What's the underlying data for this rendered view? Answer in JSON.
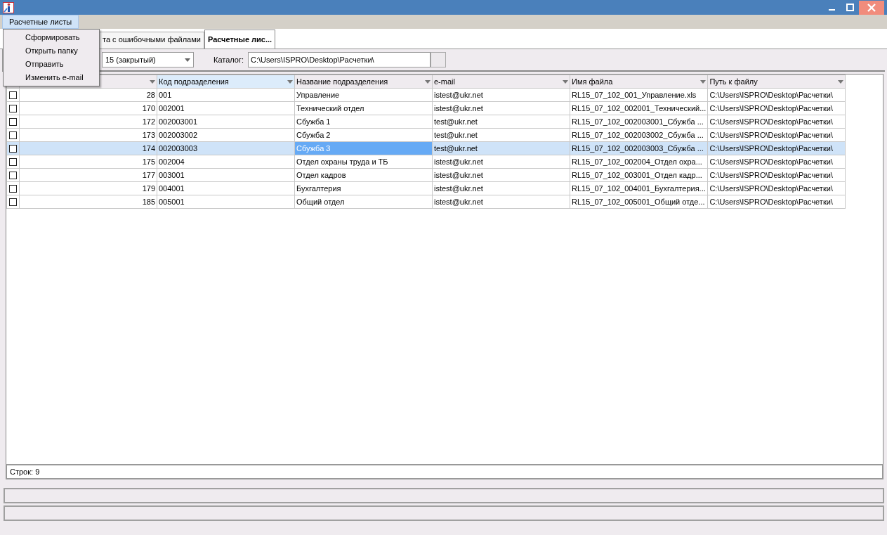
{
  "menu_bar": [
    {
      "label": "Расчетные листы",
      "selected": true
    }
  ],
  "dropdown": [
    {
      "label": "Сформировать"
    },
    {
      "label": "Открыть папку"
    },
    {
      "label": "Отправить"
    },
    {
      "label": "Изменить e-mail"
    }
  ],
  "tabs": [
    {
      "label": "та с ошибочными файлами",
      "selected": false
    },
    {
      "label": "Расчетные лис...",
      "selected": true
    }
  ],
  "period_select": {
    "value": "15 (закрытый)"
  },
  "catalog": {
    "label": "Каталог:",
    "value": "C:\\Users\\ISPRO\\Desktop\\Расчетки\\"
  },
  "table": {
    "columns": [
      {
        "highlighted": false,
        "focused": false
      },
      {
        "label": "Код подразделения",
        "highlighted": true,
        "focused": false
      },
      {
        "label": "Название подразделения",
        "highlighted": false,
        "focused": true
      },
      {
        "label": "e-mail",
        "highlighted": false,
        "focused": false
      },
      {
        "label": "Имя файла",
        "highlighted": false,
        "focused": false
      },
      {
        "label": "Путь к файлу",
        "highlighted": false,
        "focused": false
      }
    ],
    "rows": [
      {
        "checked": false,
        "selected": false,
        "cells": [
          "28",
          "001",
          "Управление",
          "istest@ukr.net",
          "RL15_07_102_001_Управление.xls",
          "C:\\Users\\ISPRO\\Desktop\\Расчетки\\"
        ]
      },
      {
        "checked": false,
        "selected": false,
        "cells": [
          "170",
          "002001",
          "Технический отдел",
          "istest@ukr.net",
          "RL15_07_102_002001_Технический...",
          "C:\\Users\\ISPRO\\Desktop\\Расчетки\\"
        ]
      },
      {
        "checked": false,
        "selected": false,
        "cells": [
          "172",
          "002003001",
          "Сбужба 1",
          "test@ukr.net",
          "RL15_07_102_002003001_Сбужба ...",
          "C:\\Users\\ISPRO\\Desktop\\Расчетки\\"
        ]
      },
      {
        "checked": false,
        "selected": false,
        "cells": [
          "173",
          "002003002",
          "Сбужба 2",
          "test@ukr.net",
          "RL15_07_102_002003002_Сбужба ...",
          "C:\\Users\\ISPRO\\Desktop\\Расчетки\\"
        ]
      },
      {
        "checked": false,
        "selected": true,
        "cells": [
          "174",
          "002003003",
          "Сбужба 3",
          "test@ukr.net",
          "RL15_07_102_002003003_Сбужба ...",
          "C:\\Users\\ISPRO\\Desktop\\Расчетки\\"
        ]
      },
      {
        "checked": false,
        "selected": false,
        "cells": [
          "175",
          "002004",
          "Отдел охраны труда и ТБ",
          "istest@ukr.net",
          "RL15_07_102_002004_Отдел охра...",
          "C:\\Users\\ISPRO\\Desktop\\Расчетки\\"
        ]
      },
      {
        "checked": false,
        "selected": false,
        "cells": [
          "177",
          "003001",
          "Отдел кадров",
          "istest@ukr.net",
          "RL15_07_102_003001_Отдел кадр...",
          "C:\\Users\\ISPRO\\Desktop\\Расчетки\\"
        ]
      },
      {
        "checked": false,
        "selected": false,
        "cells": [
          "179",
          "004001",
          "Бухгалтерия",
          "istest@ukr.net",
          "RL15_07_102_004001_Бухгалтерия...",
          "C:\\Users\\ISPRO\\Desktop\\Расчетки\\"
        ]
      },
      {
        "checked": false,
        "selected": false,
        "cells": [
          "185",
          "005001",
          "Общий отдел",
          "istest@ukr.net",
          "RL15_07_102_005001_Общий отде...",
          "C:\\Users\\ISPRO\\Desktop\\Расчетки\\"
        ]
      }
    ]
  },
  "row_count": "Строк: 9"
}
